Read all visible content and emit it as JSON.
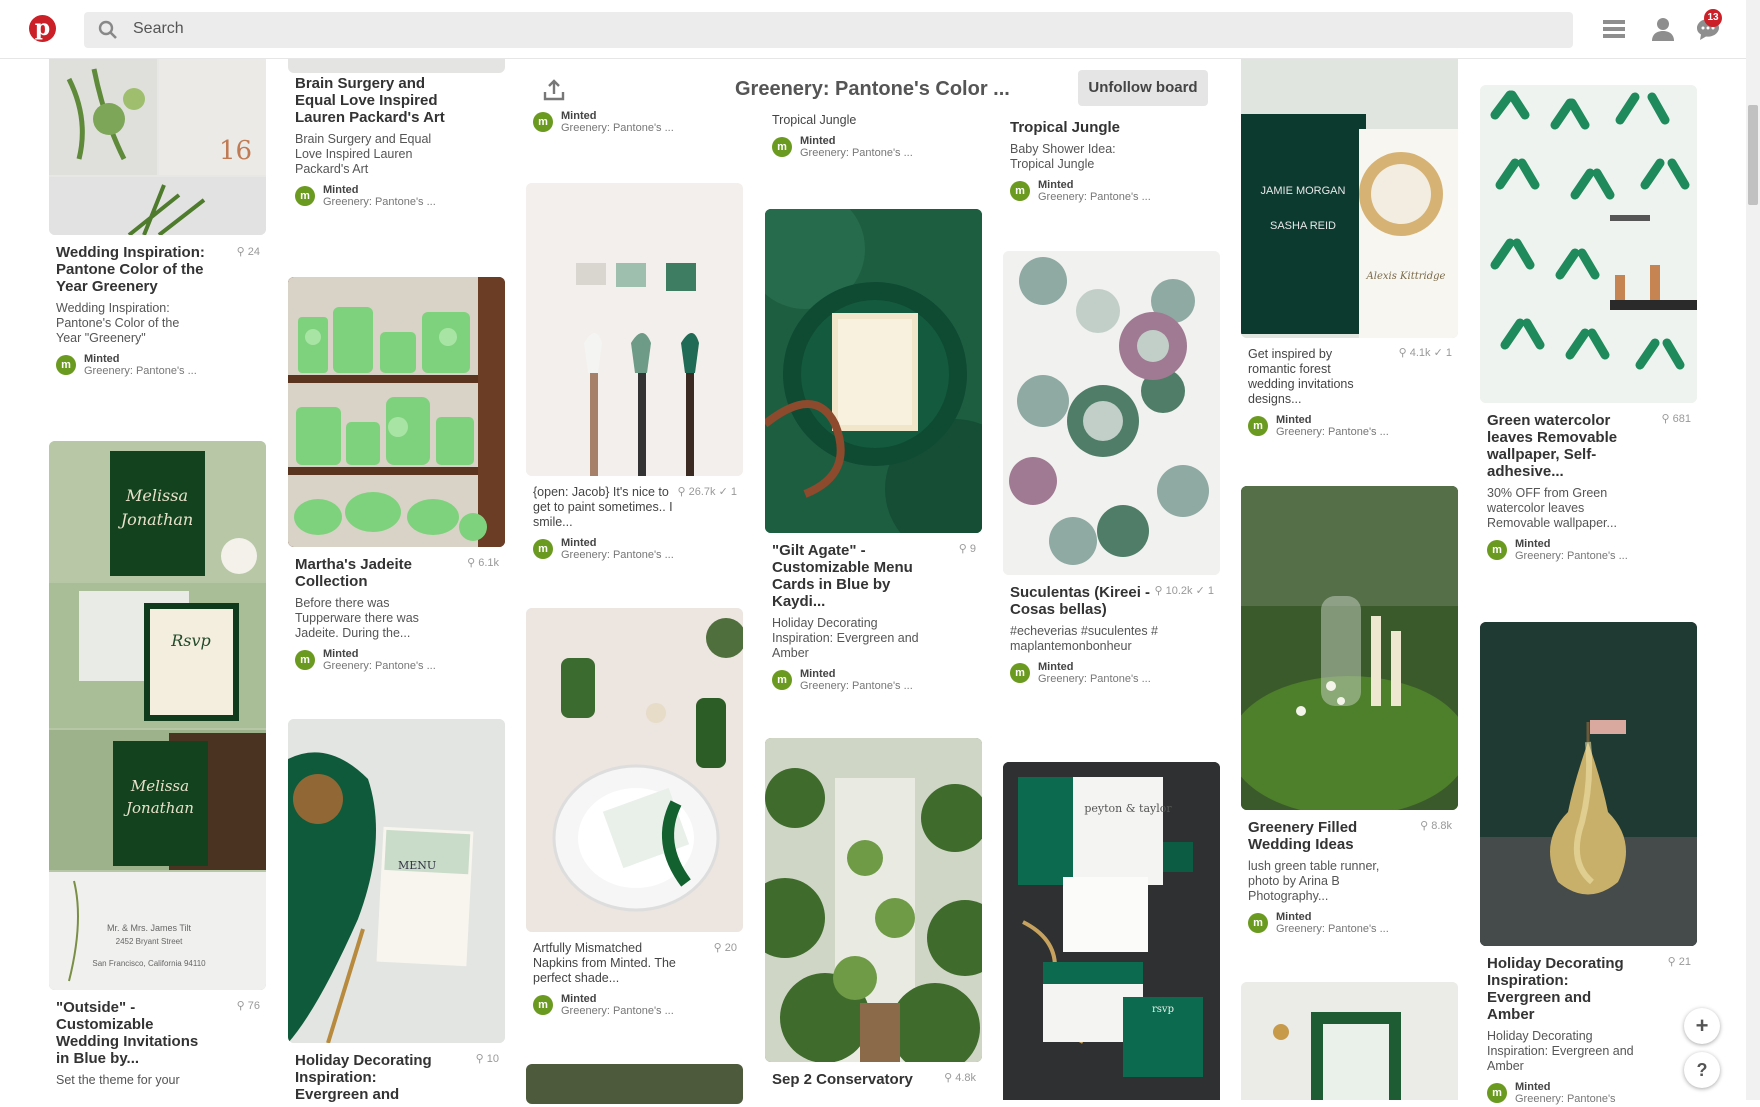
{
  "header": {
    "logo_letter": "p",
    "search_placeholder": "Search",
    "notification_count": "13",
    "icons": [
      "pinterest-logo",
      "search-icon",
      "menu-icon",
      "profile-icon",
      "messages-icon"
    ]
  },
  "board": {
    "title": "Greenery: Pantone's Color ...",
    "unfollow_label": "Unfollow board"
  },
  "pins": {
    "c1p1": {
      "title": "Wedding Inspiration: Pantone Color of the Year Greenery",
      "count": "24",
      "desc": "Wedding Inspiration: Pantone's Color of the Year \"Greenery\"",
      "by": "Minted",
      "board": "Greenery: Pantone's ..."
    },
    "c1p2": {
      "title": "\"Outside\" - Customizable Wedding Invitations in Blue by...",
      "count": "76",
      "desc": "Set the theme for your"
    },
    "c2p0": {
      "title": "Brain Surgery and Equal Love Inspired Lauren Packard's Art",
      "desc": "Brain Surgery and Equal Love Inspired Lauren Packard's Art",
      "by": "Minted",
      "board": "Greenery: Pantone's ..."
    },
    "c2p1": {
      "title": "Martha's Jadeite Collection",
      "count": "6.1k",
      "desc": "Before there was Tupperware there was Jadeite. During the...",
      "by": "Minted",
      "board": "Greenery: Pantone's ..."
    },
    "c2p2": {
      "title": "Holiday Decorating Inspiration: Evergreen and",
      "count": "10"
    },
    "c3p0": {
      "by": "Minted",
      "board": "Greenery: Pantone's ..."
    },
    "c3p1": {
      "title": "{open: Jacob} It's nice to get to paint sometimes.. I smile...",
      "count": "26.7k",
      "repins": "1",
      "by": "Minted",
      "board": "Greenery: Pantone's ..."
    },
    "c3p2": {
      "title": "Artfully Mismatched Napkins from Minted. The perfect shade...",
      "count": "20",
      "by": "Minted",
      "board": "Greenery: Pantone's ..."
    },
    "c4p0": {
      "title": "Tropical Jungle",
      "by": "Minted",
      "board": "Greenery: Pantone's ..."
    },
    "c4p1": {
      "title": "\"Gilt Agate\" - Customizable Menu Cards in Blue by Kaydi...",
      "count": "9",
      "desc": "Holiday Decorating Inspiration: Evergreen and Amber",
      "by": "Minted",
      "board": "Greenery: Pantone's ..."
    },
    "c4p2": {
      "title": "Sep 2 Conservatory",
      "count": "4.8k"
    },
    "c5p0": {
      "title": "Tropical Jungle",
      "desc": "Baby Shower Idea: Tropical Jungle",
      "by": "Minted",
      "board": "Greenery: Pantone's ..."
    },
    "c5p1": {
      "title": "Suculentas (Kireei - Cosas bellas)",
      "count": "10.2k",
      "repins": "1",
      "desc": "#echeverias #suculentes #maplantemonbonheur",
      "by": "Minted",
      "board": "Greenery: Pantone's ..."
    },
    "c6p1": {
      "desc": "Get inspired by romantic forest wedding invitations designs...",
      "count": "4.1k",
      "repins": "1",
      "by": "Minted",
      "board": "Greenery: Pantone's ..."
    },
    "c6p2": {
      "title": "Greenery Filled Wedding Ideas",
      "count": "8.8k",
      "desc": "lush green table runner, photo by Arina B Photography...",
      "by": "Minted",
      "board": "Greenery: Pantone's ..."
    },
    "c7p1": {
      "title": "Green watercolor leaves Removable wallpaper, Self-adhesive...",
      "count": "681",
      "desc": "30% OFF from Green watercolor leaves Removable wallpaper...",
      "by": "Minted",
      "board": "Greenery: Pantone's ..."
    },
    "c7p2": {
      "title": "Holiday Decorating Inspiration: Evergreen and Amber",
      "count": "21",
      "desc": "Holiday Decorating Inspiration: Evergreen and Amber",
      "by": "Minted",
      "board": "Greenery: Pantone's"
    }
  },
  "invites": {
    "names1": "Melissa",
    "names2": "Jonathan",
    "rsvp": "Rsvp",
    "menu": "MENU",
    "card_names": "peyton & taylor",
    "rsvp2": "rsvp",
    "jm": "JAMIE MORGAN",
    "sr": "SASHA REID"
  },
  "fab": {
    "plus": "+",
    "help": "?"
  },
  "colors": {
    "brand": "#cb2027",
    "minted_avatar": "#6a9a1f"
  }
}
